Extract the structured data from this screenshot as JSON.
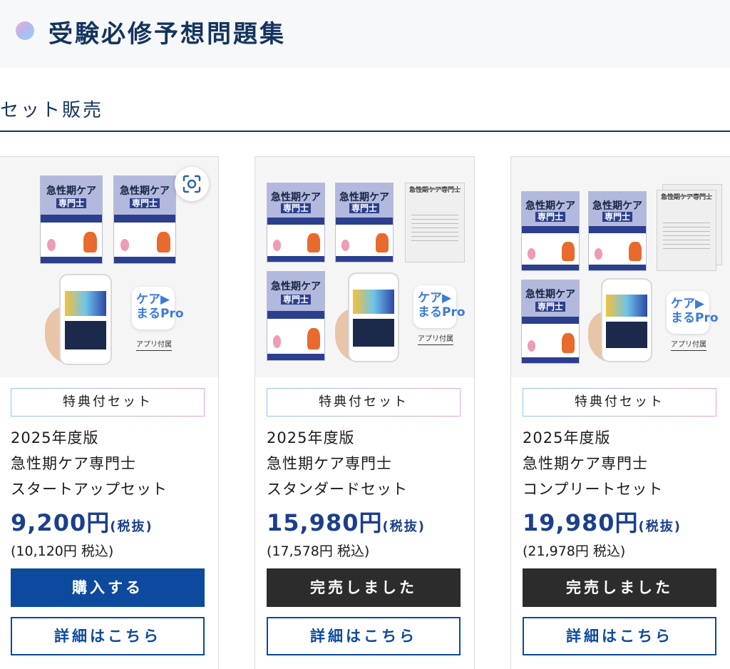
{
  "header": {
    "title": "受験必修予想問題集"
  },
  "section": {
    "title": "セット販売"
  },
  "colors": {
    "brand": "#0d4a9e",
    "sold_out": "#2c2c2c",
    "title": "#14345f"
  },
  "book_cover": {
    "title": "急性期ケア",
    "subtitle": "専門士"
  },
  "mock_exam": {
    "title": "急性期ケア専門士"
  },
  "app": {
    "icon_text": "ケア▶\nまるPro",
    "label": "アプリ付属"
  },
  "products": [
    {
      "badge": "特典付セット",
      "edition": "2025年度版",
      "name": "急性期ケア専門士",
      "set_name": "スタートアップセット",
      "price": "9,200円",
      "tax_excluded_label": "(税抜)",
      "tax_included": "(10,120円 税込)",
      "action_label": "購入する",
      "action_state": "available",
      "detail_label": "詳細はこちら"
    },
    {
      "badge": "特典付セット",
      "edition": "2025年度版",
      "name": "急性期ケア専門士",
      "set_name": "スタンダードセット",
      "price": "15,980円",
      "tax_excluded_label": "(税抜)",
      "tax_included": "(17,578円 税込)",
      "action_label": "完売しました",
      "action_state": "sold_out",
      "detail_label": "詳細はこちら"
    },
    {
      "badge": "特典付セット",
      "edition": "2025年度版",
      "name": "急性期ケア専門士",
      "set_name": "コンプリートセット",
      "price": "19,980円",
      "tax_excluded_label": "(税抜)",
      "tax_included": "(21,978円 税込)",
      "action_label": "完売しました",
      "action_state": "sold_out",
      "detail_label": "詳細はこちら"
    }
  ]
}
